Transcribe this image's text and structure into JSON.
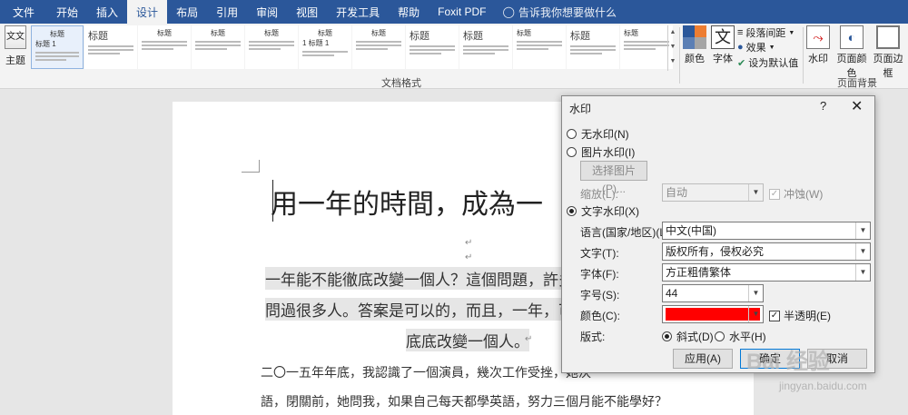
{
  "tabs": {
    "file": "文件",
    "items": [
      "开始",
      "插入",
      "设计",
      "布局",
      "引用",
      "审阅",
      "视图",
      "开发工具",
      "帮助",
      "Foxit PDF"
    ],
    "active": "设计",
    "tell_me": "告诉我你想要做什么"
  },
  "ribbon": {
    "theme_label": "主题",
    "theme_icon_text": "文文",
    "styles": [
      {
        "title": "标题",
        "sub": "标题 1"
      },
      {
        "title": "标题"
      },
      {
        "title": "标题"
      },
      {
        "title": "标题"
      },
      {
        "title": "标题"
      },
      {
        "title": "标题",
        "sub": "1 标题 1"
      },
      {
        "title": "标题"
      },
      {
        "title": "标题"
      },
      {
        "title": "标题"
      },
      {
        "title": "标题"
      },
      {
        "title": "标题"
      },
      {
        "title": "标题"
      }
    ],
    "group_document_format": "文档格式",
    "colors_label": "颜色",
    "fonts_label": "字体",
    "fonts_icon_text": "文",
    "paragraph_spacing": "段落间距",
    "effects": "效果",
    "set_default": "设为默认值",
    "watermark_label": "水印",
    "page_color_label": "页面颜色",
    "page_border_label": "页面边框",
    "group_page_background": "页面背景"
  },
  "document": {
    "title": "用一年的時間，成為一",
    "para1_line1": "一年能不能徹底改變一個人？這個問題，許多",
    "para1_line2": "問過很多人。答案是可以的，而且，一年，可",
    "para1_line3": "底底改變一個人。",
    "para2_line1": "二〇一五年年底，我認識了一個演員，幾次工作受挫，她決",
    "para2_line2": "語，閉關前，她問我，如果自己每天都學英語，努力三個月能不能學好？"
  },
  "dialog": {
    "title": "水印",
    "help": "?",
    "close": "✕",
    "no_watermark": "无水印(N)",
    "picture_watermark": "图片水印(I)",
    "select_picture": "选择图片(P)...",
    "scale_label": "缩放(L):",
    "scale_value": "自动",
    "washout": "冲蚀(W)",
    "text_watermark": "文字水印(X)",
    "language_label": "语言(国家/地区)(L):",
    "language_value": "中文(中国)",
    "text_label": "文字(T):",
    "text_value": "版权所有，侵权必究",
    "font_label": "字体(F):",
    "font_value": "方正粗倩繁体",
    "size_label": "字号(S):",
    "size_value": "44",
    "color_label": "颜色(C):",
    "color_value": "#ff0000",
    "semitransparent": "半透明(E)",
    "layout_label": "版式:",
    "diagonal": "斜式(D)",
    "horizontal": "水平(H)",
    "apply": "应用(A)",
    "ok": "确定",
    "cancel": "取消"
  },
  "overlay": {
    "logo": "Bai 经验",
    "url": "jingyan.baidu.com"
  }
}
